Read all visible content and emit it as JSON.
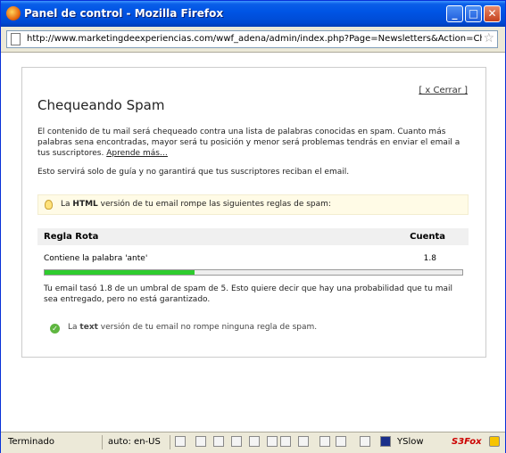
{
  "window": {
    "title": "Panel de control - Mozilla Firefox",
    "minimize": "_",
    "maximize": "□",
    "close": "✕"
  },
  "address": {
    "url": "http://www.marketingdeexperiencias.com/wwf_adena/admin/index.php?Page=Newsletters&Action=CheckSpar"
  },
  "dialog": {
    "close_link": "[ x Cerrar ]",
    "heading": "Chequeando Spam",
    "intro": "El contenido de tu mail será chequeado contra una lista de palabras conocidas en spam. Cuanto más palabras sena encontradas, mayor será tu posición y menor será problemas tendrás en enviar el email a tus suscriptores.",
    "learn_more": "Aprende más…",
    "guide_note": "Esto servirá solo de guía y no garantirá que tus suscriptores reciban el email.",
    "html_notice_pre": "La",
    "html_notice_bold": "HTML",
    "html_notice_post": "versión de tu email rompe las siguientes reglas de spam:",
    "table": {
      "col_rule": "Regla Rota",
      "col_count": "Cuenta",
      "rows": [
        {
          "rule": "Contiene la palabra 'ante'",
          "count": "1.8"
        }
      ]
    },
    "score_fraction": 0.36,
    "score_text": "Tu email tasó 1.8 de un umbral de spam de 5. Esto quiere decir que hay una probabilidad que tu mail sea entregado, pero no está garantizado.",
    "text_notice_pre": "La",
    "text_notice_bold": "text",
    "text_notice_post": "versión de tu email no rompe ninguna regla de spam."
  },
  "statusbar": {
    "status": "Terminado",
    "lang": "auto: en-US",
    "yslow": "YSlow",
    "s3fox": "S3Fox"
  },
  "icons": [
    "firefox-icon",
    "page-icon",
    "bookmark-star-icon",
    "lightbulb-icon",
    "check-icon"
  ]
}
